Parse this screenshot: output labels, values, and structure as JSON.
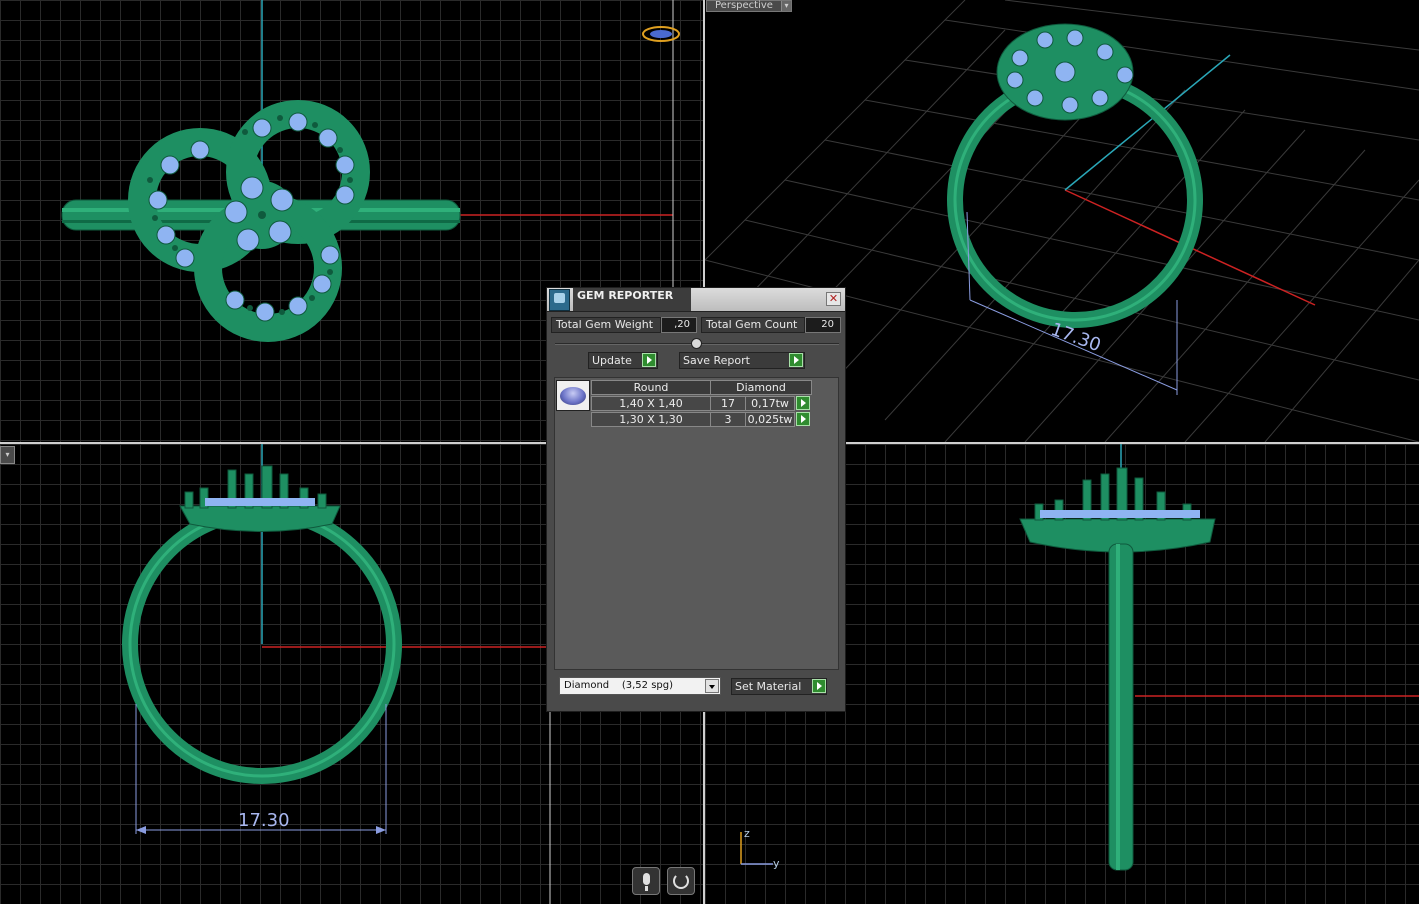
{
  "viewports": {
    "top_right_label": "Perspective",
    "bottom_left_dimension": "17.30",
    "top_right_dimension": "17.30",
    "axis_z": "z",
    "axis_y": "y"
  },
  "gem_reporter": {
    "title": "GEM REPORTER",
    "total_gem_weight_label": "Total Gem Weight",
    "total_gem_weight_value": ",20",
    "total_gem_count_label": "Total Gem Count",
    "total_gem_count_value": "20",
    "update_label": "Update",
    "save_report_label": "Save Report",
    "table": {
      "headers": [
        "Round",
        "Diamond"
      ],
      "rows": [
        {
          "size": "1,40 X 1,40",
          "count": "17",
          "weight": "0,17tw"
        },
        {
          "size": "1,30 X 1,30",
          "count": "3",
          "weight": "0,025tw"
        }
      ]
    },
    "material_select_value": "Diamond    (3,52 spg)",
    "set_material_label": "Set Material"
  },
  "colors": {
    "metal": "#1e8f62",
    "gem": "#8fb4f2",
    "dimension": "#a8b7f0",
    "axis_red": "#cc2222",
    "axis_cyan": "#2aa7b8"
  }
}
